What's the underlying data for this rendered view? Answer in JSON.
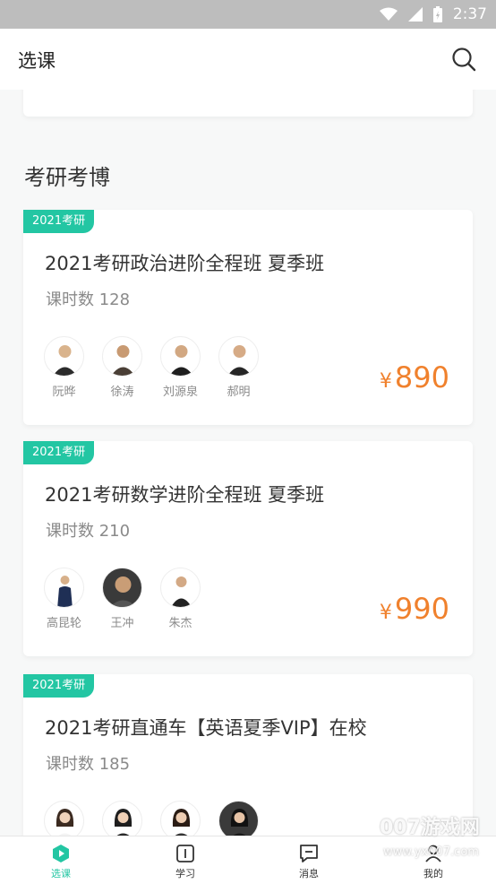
{
  "status_bar": {
    "time": "2:37"
  },
  "header": {
    "title": "选课"
  },
  "section": {
    "title": "考研考博"
  },
  "cards": [
    {
      "tag": "2021考研",
      "title": "2021考研政治进阶全程班 夏季班",
      "hours": "课时数 128",
      "teachers": [
        "阮晔",
        "徐涛",
        "刘源泉",
        "郝明"
      ],
      "price_symbol": "¥",
      "price": "890"
    },
    {
      "tag": "2021考研",
      "title": "2021考研数学进阶全程班 夏季班",
      "hours": "课时数 210",
      "teachers": [
        "高昆轮",
        "王冲",
        "朱杰"
      ],
      "price_symbol": "¥",
      "price": "990"
    },
    {
      "tag": "2021考研",
      "title": "2021考研直通车【英语夏季VIP】在校",
      "hours": "课时数 185",
      "teachers": [],
      "price_symbol": "¥",
      "price": ""
    }
  ],
  "nav": {
    "items": [
      "选课",
      "学习",
      "消息",
      "我的"
    ]
  },
  "watermark": {
    "main": "007游戏网",
    "url": "www.yx007.com"
  },
  "colors": {
    "accent": "#23c6a3",
    "price": "#f0812d"
  }
}
